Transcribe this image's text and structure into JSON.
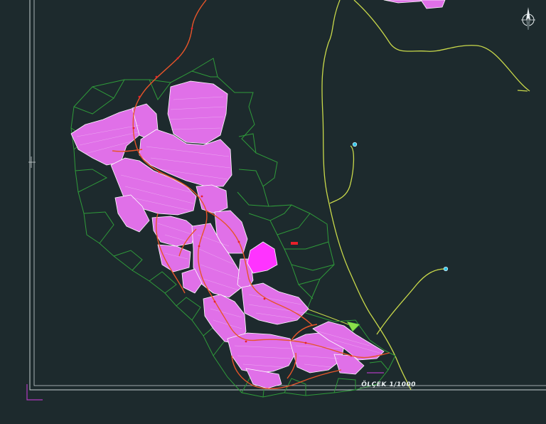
{
  "scale_label": "ÖLÇEK 1/1000",
  "icons": {
    "north_arrow": "north-arrow-icon",
    "ucs": "ucs-axis-icon",
    "crosshair": "crosshair-cursor-icon"
  },
  "colors": {
    "background": "#1d2a2d",
    "frame": "#c9d2d4",
    "parcel_fill": "#e070e8",
    "parcel_edge": "#ffffff",
    "selected_parcel": "#ff33ff",
    "road": "#e6552a",
    "lot_boundary": "#2f9b3a",
    "track": "#c9d94a",
    "point_marker": "#33c6e8",
    "red_tag": "#e8202a"
  }
}
